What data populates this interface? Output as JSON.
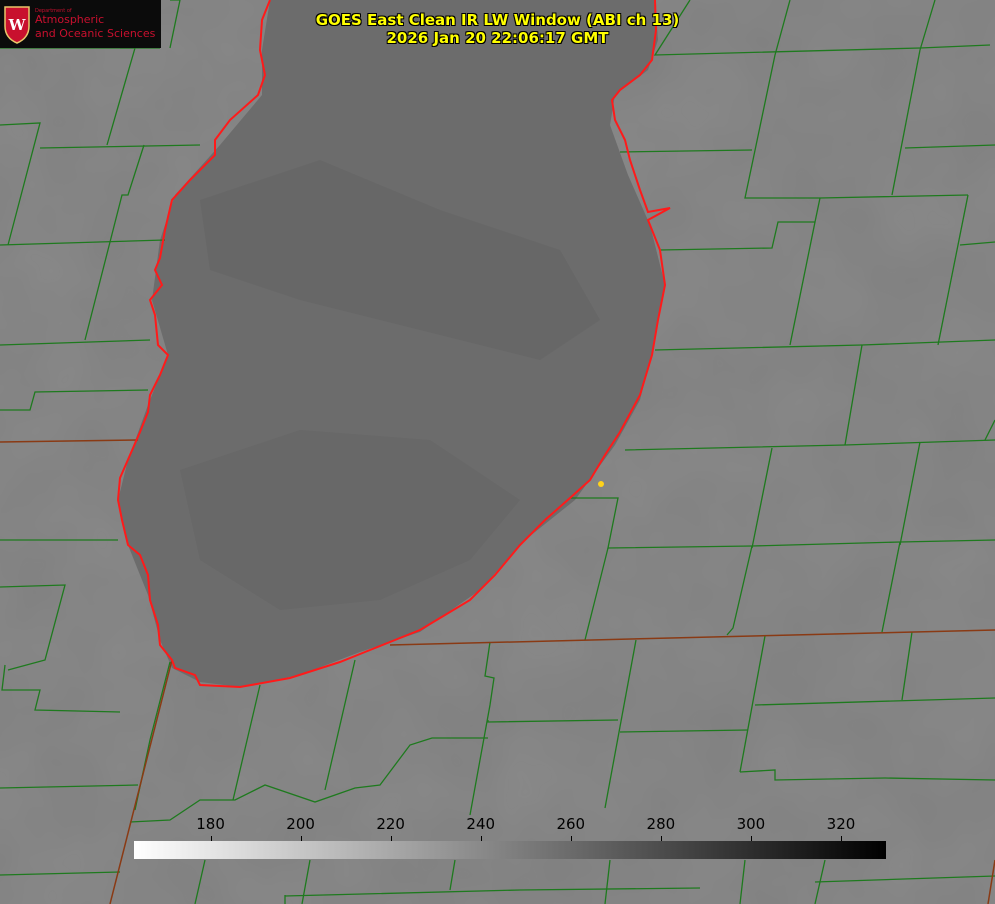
{
  "title": {
    "line1": "GOES East Clean IR LW Window (ABI ch 13)",
    "line2": "2026 Jan 20 22:06:17 GMT"
  },
  "logo": {
    "department": "Department of",
    "line1": "Atmospheric",
    "line2": "and Oceanic Sciences",
    "shield_letter": "W"
  },
  "colorbar": {
    "min": 163,
    "max": 330,
    "ticks": [
      "180",
      "200",
      "220",
      "240",
      "260",
      "280",
      "300",
      "320"
    ],
    "colormap": [
      "#ffffff",
      "#000000"
    ]
  },
  "colors": {
    "county_lines": "#1e7a1e",
    "state_lines": "#8a3a14",
    "shoreline": "#ff1a1a",
    "title_text": "#ffff00",
    "background": "#7f7f7f",
    "lake": "#6b6b6b"
  },
  "features": {
    "site_marker": "yellow-dot"
  }
}
